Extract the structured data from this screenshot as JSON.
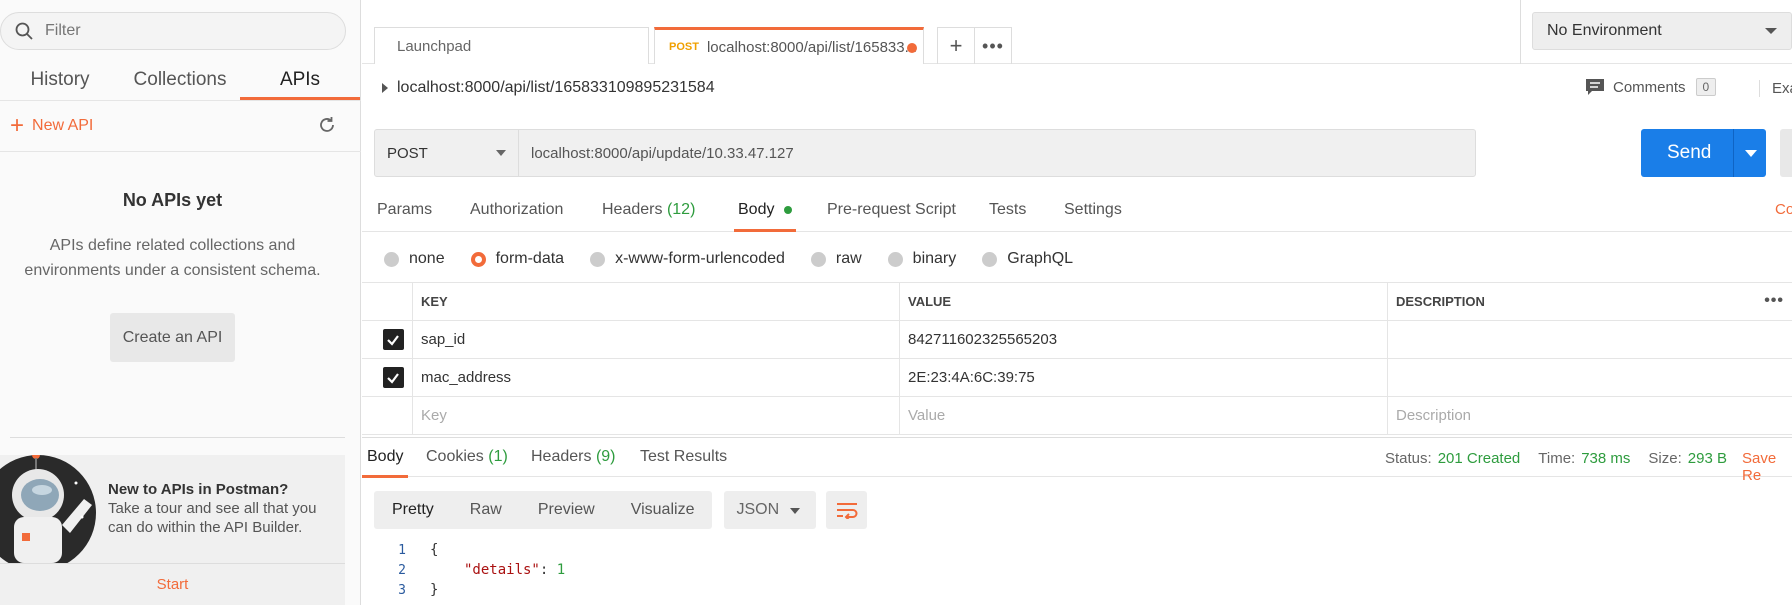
{
  "sidebar": {
    "filter_placeholder": "Filter",
    "tabs": [
      {
        "label": "History"
      },
      {
        "label": "Collections"
      },
      {
        "label": "APIs"
      }
    ],
    "new_api_label": "New API",
    "empty_title": "No APIs yet",
    "empty_description": "APIs define related collections and environments under a consistent schema.",
    "create_button": "Create an API",
    "promo": {
      "title": "New to APIs in Postman?",
      "text": "Take a tour and see all that you can do within the API Builder.",
      "start": "Start"
    }
  },
  "tabs": {
    "launchpad": "Launchpad",
    "active_method": "POST",
    "active_title": "localhost:8000/api/list/165833..."
  },
  "environment": {
    "selected": "No Environment"
  },
  "request": {
    "breadcrumb": "localhost:8000/api/list/165833109895231584",
    "comments_label": "Comments",
    "comments_count": "0",
    "examples_label": "Exam",
    "method": "POST",
    "url": "localhost:8000/api/update/10.33.47.127",
    "send_label": "Send"
  },
  "request_tabs": {
    "params": "Params",
    "authorization": "Authorization",
    "headers": "Headers",
    "headers_count": "(12)",
    "body": "Body",
    "prerequest": "Pre-request Script",
    "tests": "Tests",
    "settings": "Settings",
    "cookies_stub": "Co"
  },
  "body_types": [
    "none",
    "form-data",
    "x-www-form-urlencoded",
    "raw",
    "binary",
    "GraphQL"
  ],
  "body_type_selected": "form-data",
  "kv_table": {
    "headers": {
      "key": "KEY",
      "value": "VALUE",
      "description": "DESCRIPTION"
    },
    "rows": [
      {
        "key": "sap_id",
        "value": "842711602325565203",
        "description": ""
      },
      {
        "key": "mac_address",
        "value": "2E:23:4A:6C:39:75",
        "description": ""
      }
    ],
    "placeholder": {
      "key": "Key",
      "value": "Value",
      "description": "Description"
    }
  },
  "response": {
    "tabs": {
      "body": "Body",
      "cookies": "Cookies",
      "cookies_count": "(1)",
      "headers": "Headers",
      "headers_count": "(9)",
      "test_results": "Test Results"
    },
    "status_label": "Status:",
    "status_value": "201 Created",
    "time_label": "Time:",
    "time_value": "738 ms",
    "size_label": "Size:",
    "size_value": "293 B",
    "save_label": "Save Re",
    "format_buttons": [
      "Pretty",
      "Raw",
      "Preview",
      "Visualize"
    ],
    "language": "JSON",
    "code_lines": [
      {
        "num": "1",
        "open": "{"
      },
      {
        "num": "2",
        "key": "\"details\"",
        "colon": ": ",
        "value": "1"
      },
      {
        "num": "3",
        "close": "}"
      }
    ]
  },
  "colors": {
    "accent": "#f26b3a",
    "send_blue": "#1a7ee8",
    "success_green": "#2e9c3e"
  }
}
